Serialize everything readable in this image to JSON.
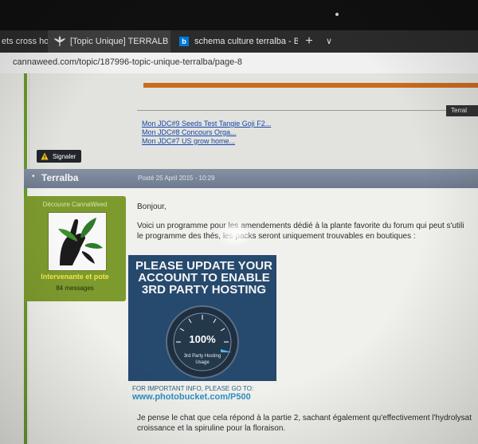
{
  "browser": {
    "tabs": [
      {
        "label": "ets cross ho",
        "active": false
      },
      {
        "label": "[Topic Unique] TERRALB",
        "active": true,
        "icon": "cannabis-leaf-icon"
      },
      {
        "label": "schema culture terralba - Bi",
        "active": false,
        "icon": "bing-icon"
      }
    ],
    "url": "cannaweed.com/topic/187996-topic-unique-terralba/page-8"
  },
  "signature": {
    "user_button": "Terral",
    "links": [
      "Mon JDC#9 Seeds Test Tangie Goji F2...",
      "Mon JDC#8 Concours Orga...",
      "Mon JDC#7 US grow home..."
    ]
  },
  "report_button": "Signaler",
  "post": {
    "author": "Terralba",
    "date": "Posté 25 April 2015 - 10:29",
    "user": {
      "rank": "Découvre CannaWeed",
      "title": "Intervenante et pote",
      "messages": "84 messages"
    },
    "lines": [
      "Bonjour,",
      "Voici un programme pour les amendements dédié à la plante favorite du forum qui peut s'utili",
      "le programme des thés, les packs seront uniquement trouvables en boutiques :",
      "Je pense le chat que cela répond à la partie 2, sachant également qu'effectivement l'hydrolysat",
      "croissance et la spiruline pour la floraison."
    ],
    "image": {
      "headline": [
        "PLEASE UPDATE YOUR",
        "ACCOUNT TO ENABLE",
        "3RD PARTY HOSTING"
      ],
      "gauge_value": "100%",
      "gauge_caption": [
        "3rd Party Hosting",
        "Usage"
      ],
      "notice": "FOR IMPORTANT INFO, PLEASE GO TO:",
      "url": "www.photobucket.com/P500"
    }
  },
  "colors": {
    "accent_green": "#7d9a2e",
    "link_blue": "#1a46a8",
    "header_slate": "#7a8598",
    "orange": "#c96c1f"
  }
}
